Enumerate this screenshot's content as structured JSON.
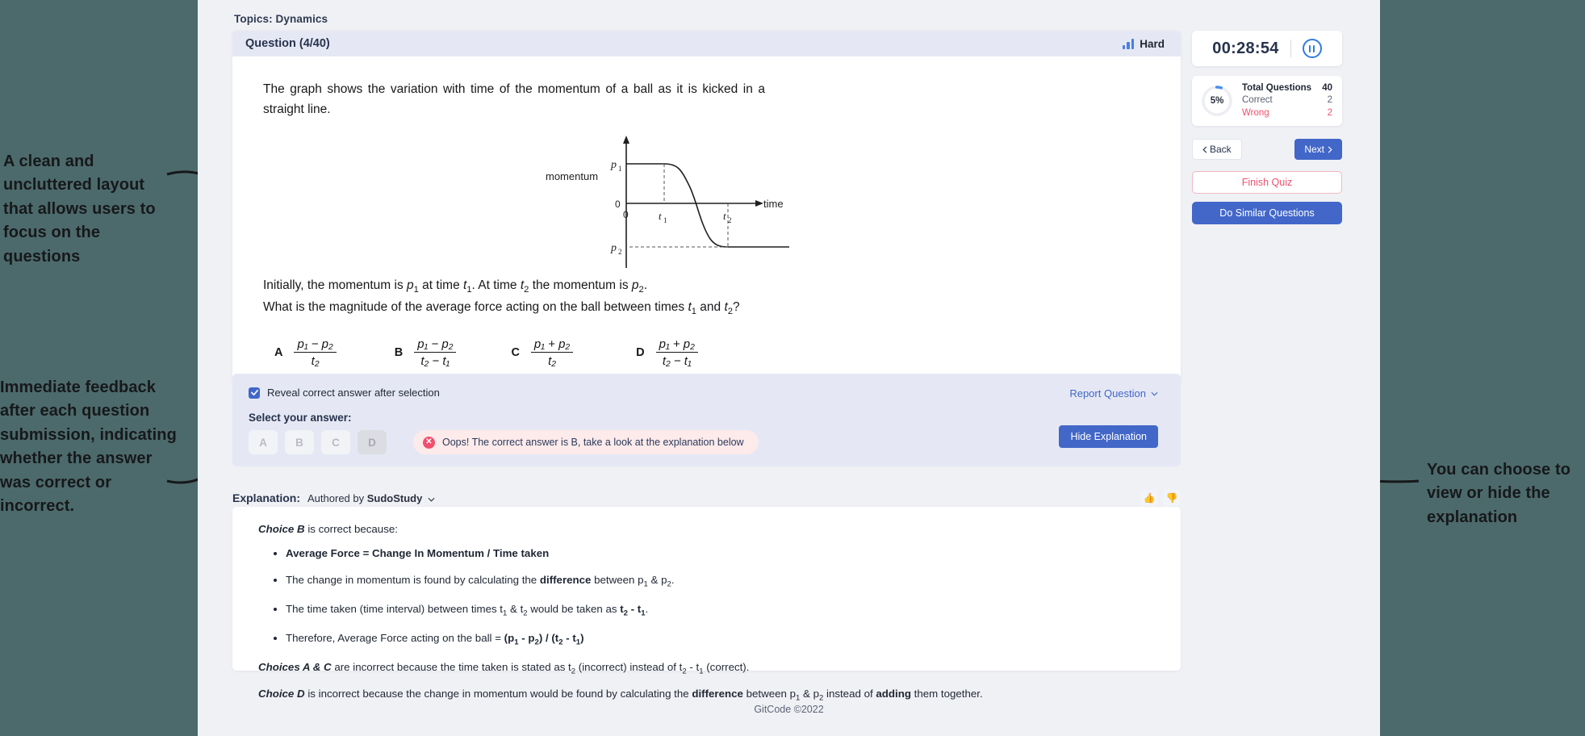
{
  "annotations": {
    "left_top": "A clean and uncluttered layout that allows users to focus on the questions",
    "left_bottom": "Immediate feedback after each question submission, indicating whether the answer was correct or incorrect.",
    "right": "You can choose to view or hide the explanation"
  },
  "topics": "Topics: Dynamics",
  "question": {
    "header": "Question (4/40)",
    "difficulty": "Hard",
    "paragraph1": "The graph shows the variation with time of the momentum of a ball as it is kicked in a straight line.",
    "paragraph2_parts": [
      "Initially, the momentum is ",
      "p",
      "1",
      " at time ",
      "t",
      "1",
      ". At time ",
      "t",
      "2",
      " the momentum is ",
      "p",
      "2",
      "."
    ],
    "paragraph3_parts": [
      "What is the magnitude of the average force acting on the ball between times ",
      "t",
      "1",
      " and ",
      "t",
      "2",
      "?"
    ],
    "options": [
      {
        "letter": "A",
        "numerator": "p₁ − p₂",
        "denominator": "t₂"
      },
      {
        "letter": "B",
        "numerator": "p₁ − p₂",
        "denominator": "t₂ − t₁"
      },
      {
        "letter": "C",
        "numerator": "p₁ + p₂",
        "denominator": "t₂"
      },
      {
        "letter": "D",
        "numerator": "p₁ + p₂",
        "denominator": "t₂ − t₁"
      }
    ]
  },
  "chart_data": {
    "type": "line",
    "title": "",
    "xlabel": "time",
    "ylabel": "momentum",
    "x_ticks": [
      "0",
      "t₁",
      "t₂"
    ],
    "y_ticks": [
      "p₁",
      "0",
      "p₂"
    ],
    "annotations": [
      "dashed guide at t₁ up to p₁",
      "dashed guide at t₂ down to p₂"
    ],
    "series": [
      {
        "name": "momentum",
        "description": "Constant at p₁ until t₁, sigmoid decrease crossing zero, levels off at p₂ by t₂",
        "x": [
          0,
          1,
          2,
          3,
          4,
          5,
          6,
          7,
          8
        ],
        "y": [
          1,
          1,
          1,
          0.85,
          0.0,
          -0.85,
          -1,
          -1,
          -1
        ]
      }
    ],
    "grid": false,
    "legend": "none"
  },
  "answer_panel": {
    "reveal_label": "Reveal correct answer after selection",
    "reveal_checked": true,
    "select_label": "Select your answer:",
    "choices": [
      "A",
      "B",
      "C",
      "D"
    ],
    "selected_choice": "D",
    "alert_text": "Oops! The correct answer is B, take a look at the explanation below",
    "alert_icon": "error-circle-icon",
    "report_label": "Report Question",
    "hide_explanation_label": "Hide Explanation"
  },
  "explanation": {
    "title": "Explanation:",
    "author_prefix": "Authored by ",
    "author": "SudoStudy",
    "thumb_up": "👍",
    "thumb_down": "👎",
    "intro_em": "Choice B",
    "intro_rest": " is correct because:",
    "bullets": [
      {
        "html": "<b>Average Force = Change In Momentum / Time taken</b>"
      },
      {
        "html": "The change in momentum is found by calculating the <b>difference</b> between p<sub>1</sub> &amp; p<sub>2</sub>."
      },
      {
        "html": "The time taken (time interval) between times t<sub>1</sub> &amp; t<sub>2</sub> would be taken as <b>t<sub>2</sub> - t<sub>1</sub></b>."
      },
      {
        "html": "Therefore, Average Force acting on the ball = <b>(p<sub>1</sub> - p<sub>2</sub>) / (t<sub>2</sub> - t<sub>1</sub>)</b>"
      }
    ],
    "tail1_html": "<em>Choices A &amp; C</em> are incorrect because the time taken is stated as t<sub>2</sub> (incorrect) instead of t<sub>2</sub> - t<sub>1</sub> (correct).",
    "tail2_html": "<em>Choice D</em> is incorrect because the change in momentum would be found by calculating the <b>difference</b> between p<sub>1</sub> &amp; p<sub>2</sub> instead of <b>adding</b> them together."
  },
  "sidebar": {
    "timer": "00:28:54",
    "pause_icon": "pause-icon",
    "progress_percent": "5%",
    "stats": [
      {
        "key": "Total Questions",
        "value": "40"
      },
      {
        "key": "Correct",
        "value": "2"
      },
      {
        "key": "Wrong",
        "value": "2"
      }
    ],
    "back_label": "Back",
    "next_label": "Next",
    "finish_label": "Finish Quiz",
    "similar_label": "Do Similar Questions"
  },
  "footer": "GitCode ©2022",
  "colors": {
    "page_bg": "#4c6a6c",
    "app_bg": "#f0f1f5",
    "accent_blue": "#4267c9",
    "header_band": "#e5e8f4",
    "danger": "#f0506e"
  }
}
